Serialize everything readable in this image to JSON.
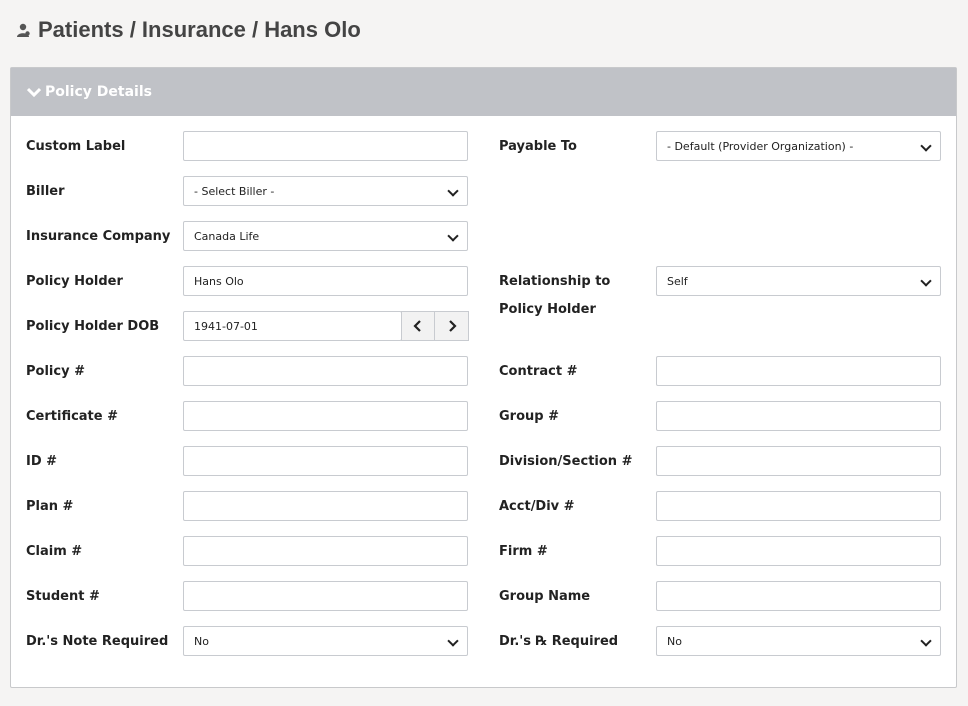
{
  "breadcrumb": "Patients / Insurance / Hans Olo",
  "panel": {
    "title": "Policy Details"
  },
  "left": {
    "custom_label": {
      "label": "Custom Label",
      "value": ""
    },
    "biller": {
      "label": "Biller",
      "value": "- Select Biller -"
    },
    "insurance_company": {
      "label": "Insurance Company",
      "value": "Canada Life"
    },
    "policy_holder": {
      "label": "Policy Holder",
      "value": "Hans Olo"
    },
    "policy_holder_dob": {
      "label": "Policy Holder DOB",
      "value": "1941-07-01"
    },
    "policy_num": {
      "label": "Policy #",
      "value": ""
    },
    "certificate_num": {
      "label": "Certificate #",
      "value": ""
    },
    "id_num": {
      "label": "ID #",
      "value": ""
    },
    "plan_num": {
      "label": "Plan #",
      "value": ""
    },
    "claim_num": {
      "label": "Claim #",
      "value": ""
    },
    "student_num": {
      "label": "Student #",
      "value": ""
    },
    "dr_note": {
      "label": "Dr.'s Note Required",
      "value": "No"
    }
  },
  "right": {
    "payable_to": {
      "label": "Payable To",
      "value": "- Default (Provider Organization) -"
    },
    "relationship_line1": "Relationship to",
    "relationship_line2": "Policy Holder",
    "relationship_value": "Self",
    "contract_num": {
      "label": "Contract #",
      "value": ""
    },
    "group_num": {
      "label": "Group #",
      "value": ""
    },
    "division_section": {
      "label": "Division/Section #",
      "value": ""
    },
    "acct_div": {
      "label": "Acct/Div #",
      "value": ""
    },
    "firm_num": {
      "label": "Firm #",
      "value": ""
    },
    "group_name": {
      "label": "Group Name",
      "value": ""
    },
    "dr_rx": {
      "label": "Dr.'s ℞ Required",
      "value": "No"
    }
  },
  "icons": {
    "header": "user-icon",
    "collapse": "chevron-down-icon",
    "prev": "chevron-left-icon",
    "next": "chevron-right-icon"
  }
}
